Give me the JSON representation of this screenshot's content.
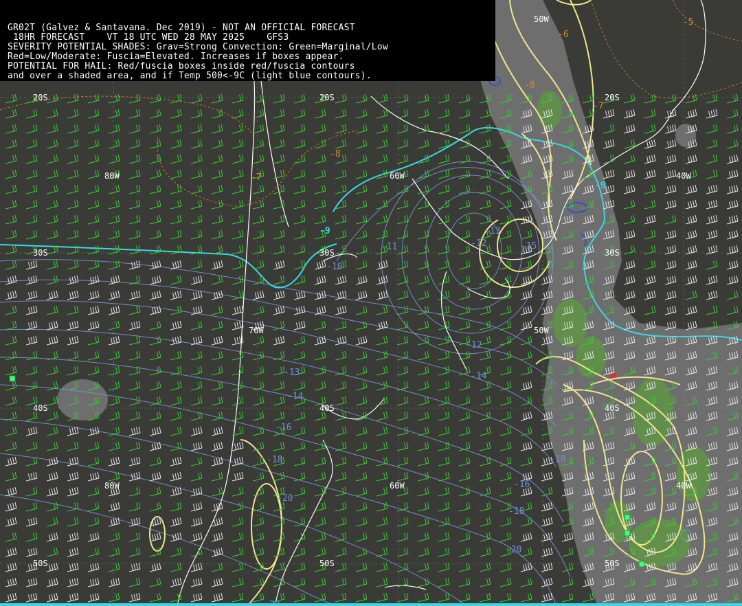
{
  "header": {
    "line1": "GR02T (Galvez & Santavana. Dec 2019) - NOT AN OFFICIAL FORECAST",
    "line2": " 18HR FORECAST    VT 18 UTC WED 28 MAY 2025    GFS3",
    "line3": "SEVERITY POTENTIAL SHADES: Grav=Strong Convection: Green=Marginal/Low",
    "line4": "Red=Low/Moderate: Fuscia=Elevated. Increases if boxes appear.",
    "line5": "POTENTIAL FOR HAIL: Red/fuscia boxes inside red/fuscia contours",
    "line6": "and over a shaded area, and if Temp 500<-9C (light blue contours)."
  },
  "grid_labels": {
    "lat_20s_left": "20S",
    "lat_20s_mid": "20S",
    "lat_20s_right": "20S",
    "lat_30s_left": "30S",
    "lat_30s_mid": "30S",
    "lat_30s_right": "30S",
    "lat_40s_left": "40S",
    "lat_40s_mid": "40S",
    "lat_40s_right": "40S",
    "lat_50s_left": "50S",
    "lat_50s_mid": "50S",
    "lat_50s_right": "50S",
    "lon_80w_top": "80W",
    "lon_80w_bottom": "80W",
    "lon_70w": "70W",
    "lon_60w_top": "60W",
    "lon_60w_bottom": "60W",
    "lon_50w_top": "50W",
    "lon_50w_mid": "50W",
    "lon_40w_top": "40W",
    "lon_40w_bottom": "40W"
  },
  "contour_labels": {
    "cyan_a": "-9",
    "cyan_b": "-9",
    "blue": [
      "-10",
      "-11",
      "-12",
      "-12",
      "-13",
      "-13",
      "-14",
      "-14",
      "-15",
      "-16",
      "-16",
      "-18",
      "-18",
      "-20",
      "-20",
      "-20",
      "-18"
    ],
    "orange": [
      "-8",
      "-8",
      "-7",
      "-6",
      "-5",
      "-7"
    ]
  },
  "colors": {
    "background": "#3a3a36",
    "header_bg": "#000000",
    "coastline": "#ffffff",
    "temp_500_contour": "#39d8e6",
    "blue_contour": "#7b97d8",
    "yellow_contour": "#f0e68c",
    "orange_contour": "#c87a28",
    "wind_barb_green": "#39d035",
    "wind_barb_white": "#e8e8e8",
    "gray_shade": "#7a7a7a",
    "green_shade": "#5e9a40",
    "hail_box": "#55ee88"
  }
}
